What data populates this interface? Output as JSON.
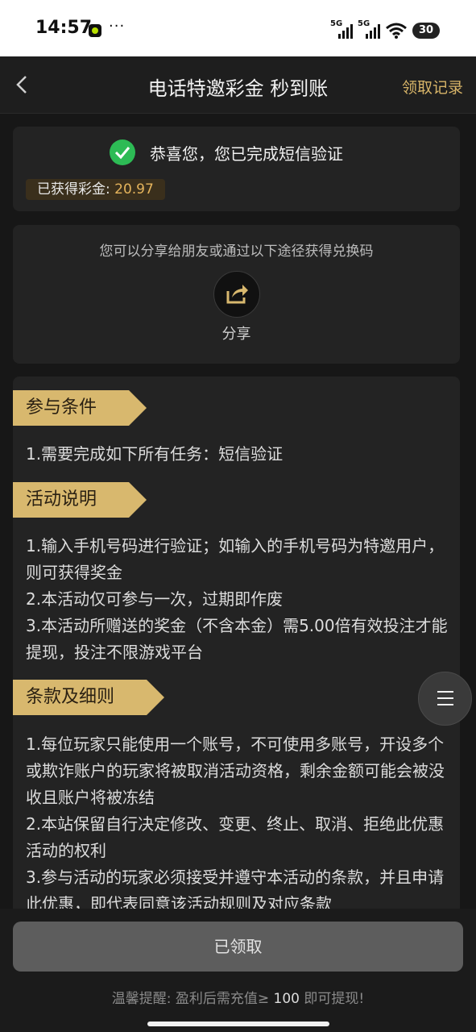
{
  "status_bar": {
    "time": "14:57",
    "dots": "···",
    "signal1_label": "5G",
    "signal2_label": "5G",
    "battery": "30"
  },
  "nav": {
    "title": "电话特邀彩金 秒到账",
    "right_link": "领取记录"
  },
  "verify_card": {
    "message": "恭喜您，您已完成短信验证",
    "bonus_label": "已获得彩金:",
    "bonus_value": "20.97"
  },
  "share_card": {
    "hint": "您可以分享给朋友或通过以下途径获得兑换码",
    "share_label": "分享"
  },
  "sections": [
    {
      "title": "参与条件",
      "lines": [
        "1.需要完成如下所有任务：短信验证"
      ]
    },
    {
      "title": "活动说明",
      "lines": [
        "1.输入手机号码进行验证；如输入的手机号码为特邀用户，则可获得奖金",
        "2.本活动仅可参与一次，过期即作废",
        "3.本活动所赠送的奖金（不含本金）需5.00倍有效投注才能提现，投注不限游戏平台"
      ]
    },
    {
      "title": "条款及细则",
      "lines": [
        "1.每位玩家只能使用一个账号，不可使用多账号，开设多个或欺诈账户的玩家将被取消活动资格，剩余金额可能会被没收且账户将被冻结",
        "2.本站保留自行决定修改、变更、终止、取消、拒绝此优惠活动的权利",
        "3.参与活动的玩家必须接受并遵守本活动的条款，并且申请此优惠，即代表同意该活动规则及对应条款"
      ]
    }
  ],
  "bottom": {
    "button_label": "已领取",
    "tip_prefix": "温馨提醒: 盈利后需充值≥ ",
    "tip_amount": "100",
    "tip_suffix": " 即可提现!"
  },
  "colors": {
    "accent_gold": "#d8b86e",
    "bonus_value": "#e5b45c",
    "success_green": "#2dbb55",
    "background": "#171717",
    "card": "#232323"
  }
}
